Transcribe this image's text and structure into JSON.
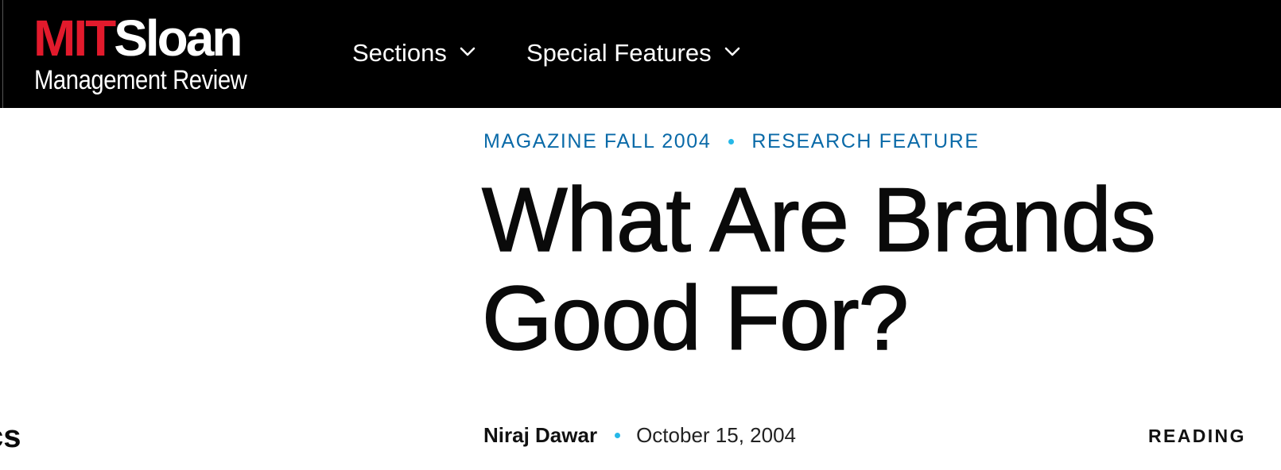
{
  "header": {
    "logo": {
      "mit": "MIT",
      "sloan": "Sloan",
      "subtitle": "Management Review"
    },
    "nav": [
      {
        "label": "Sections",
        "icon": "chevron-down-icon"
      },
      {
        "label": "Special Features",
        "icon": "chevron-down-icon"
      }
    ]
  },
  "article": {
    "kicker": {
      "issue": "MAGAZINE FALL 2004",
      "type": "RESEARCH FEATURE"
    },
    "title_line1": "What Are Brands",
    "title_line2": "Good For?",
    "author": "Niraj Dawar",
    "date": "October 15, 2004",
    "reading_label": "READING"
  },
  "sidebar_fragment": "cs",
  "colors": {
    "header_bg": "#000000",
    "mit_red": "#e21a2c",
    "kicker_blue": "#0a6aa8",
    "dot_cyan": "#26b8e8",
    "text": "#0a0a0a"
  }
}
